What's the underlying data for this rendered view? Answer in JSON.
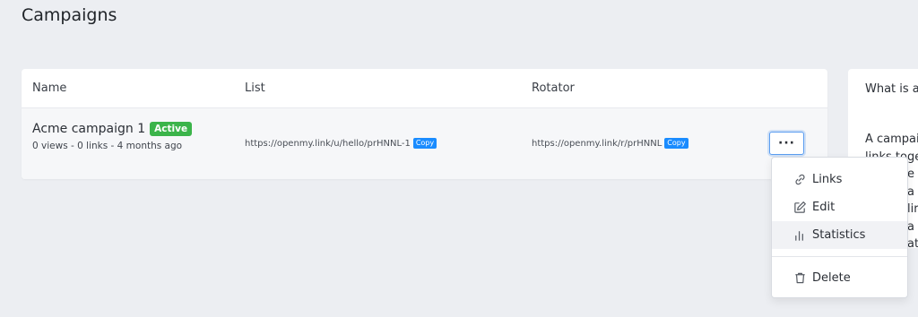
{
  "page": {
    "title": "Campaigns"
  },
  "table": {
    "headers": {
      "name": "Name",
      "list": "List",
      "rotator": "Rotator"
    },
    "rows": [
      {
        "name": "Acme campaign 1",
        "status": "Active",
        "meta": "0 views - 0 links - 4 months ago",
        "list_url": "https://openmy.link/u/hello/prHNNL-1",
        "rotator_url": "https://openmy.link/r/prHNNL",
        "copy_label": "Copy",
        "more_label": "···"
      }
    ]
  },
  "menu": {
    "items": [
      {
        "label": "Links",
        "icon": "link-icon"
      },
      {
        "label": "Edit",
        "icon": "edit-icon"
      },
      {
        "label": "Statistics",
        "icon": "bar-chart-icon"
      },
      {
        "label": "Delete",
        "icon": "trash-icon"
      }
    ]
  },
  "side_panel": {
    "title": "What is a",
    "text_lines": [
      "A campai",
      "links toge",
      "e th",
      "a n",
      "lire",
      "a",
      "at"
    ]
  },
  "colors": {
    "badge_green": "#3bb44a",
    "copy_blue": "#1a8cff",
    "background": "#eceef2"
  }
}
